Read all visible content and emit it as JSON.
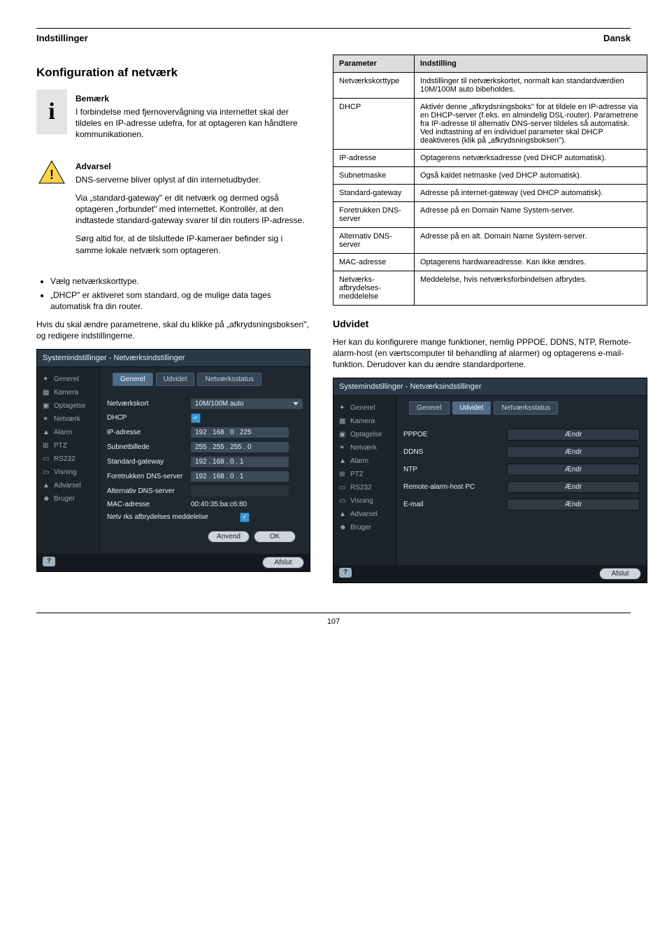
{
  "header": {
    "left": "Indstillinger",
    "right": "Dansk"
  },
  "left_col": {
    "h2": "Konfiguration af netværk",
    "note_heading": "Bemærk",
    "note_text": "I forbindelse med fjernovervågning via internettet skal der tildeles en IP-adresse udefra, for at optageren kan håndtere kommunikationen.",
    "warn_heading": "Advarsel",
    "warn_body": [
      "DNS-serverne bliver oplyst af din internetudbyder.",
      "Via „standard-gateway\" er dit netværk og dermed også optageren „forbundet\" med internettet. Kontrollér, at den indtastede standard-gateway svarer til din routers IP-adresse.",
      "Sørg altid for, at de tilsluttede IP-kameraer befinder sig i samme lokale netværk som optageren."
    ],
    "bullets": [
      "Vælg netværkskorttype.",
      "„DHCP\" er aktiveret som standard, og de mulige data tages automatisk fra din router."
    ],
    "ptext": "Hvis du skal ændre parametrene, skal du klikke på „afkrydsningsboksen\", og redigere indstillingerne."
  },
  "right_col": {
    "params": [
      {
        "p": "Parameter",
        "e": "Indstilling"
      },
      {
        "p": "Netværkskorttype",
        "e": "Indstillinger til netværkskortet, normalt kan standardværdien 10M/100M auto bibeholdes."
      },
      {
        "p": "DHCP",
        "e": "Aktivér denne „afkrydsningsboks\" for at tildele en IP-adresse via en DHCP-server (f.eks. en almindelig DSL-router). Parametrene fra IP-adresse til alternativ DNS-server tildeles så automatisk. Ved indtastning af en individuel parameter skal DHCP deaktiveres (klik på „afkrydsningsboksen\")."
      },
      {
        "p": "IP-adresse",
        "e": "Optagerens netværksadresse (ved DHCP automatisk)."
      },
      {
        "p": "Subnetmaske",
        "e": "Også kaldet netmaske (ved DHCP automatisk)."
      },
      {
        "p": "Standard-gateway",
        "e": "Adresse på internet-gateway (ved DHCP automatisk)."
      },
      {
        "p": "Foretrukken DNS-server",
        "e": "Adresse på en Domain Name System-server."
      },
      {
        "p": "Alternativ DNS-server",
        "e": "Adresse på en alt. Domain Name System-server."
      },
      {
        "p": "MAC-adresse",
        "e": "Optagerens hardwareadresse. Kan ikke ændres."
      },
      {
        "p": "Netværks-afbrydelses-meddelelse",
        "e": "Meddelelse, hvis netværksforbindelsen afbrydes."
      }
    ],
    "h3": "Udvidet",
    "ptext": "Her kan du konfigurere mange funktioner, nemlig PPPOE, DDNS, NTP, Remote-alarm-host (en værtscomputer til behandling af alarmer) og optagerens e-mail-funktion. Derudover kan du ændre standardportene."
  },
  "shot1": {
    "title": "Systemindstillinger - Netværksindstillinger",
    "sidebar": [
      "Generel",
      "Kamera",
      "Optagelse",
      "Netværk",
      "Alarm",
      "PTZ",
      "RS232",
      "Visning",
      "Advarsel",
      "Bruger"
    ],
    "tabs": [
      "Generel",
      "Udvidet",
      "Netværksstatus"
    ],
    "active_tab": 0,
    "rows": {
      "card_label": "Netværkskort",
      "card_value": "10M/100M auto",
      "dhcp_label": "DHCP",
      "ip_label": "IP-adresse",
      "ip_value": "192 . 168 . 0    . 225",
      "mask_label": "Subnetbillede",
      "mask_value": "255 . 255 . 255 . 0",
      "gw_label": "Standard-gateway",
      "gw_value": "192 . 168 . 0    . 1",
      "dns1_label": "Foretrukken DNS-server",
      "dns1_value": "192 . 168 . 0    . 1",
      "dns2_label": "Alternativ DNS-server",
      "dns2_value": "·       ·       ·",
      "mac_label": "MAC-adresse",
      "mac_value": "00:40:35:ba:c6:80",
      "disc_label": "Netv rks afbrydelses meddelelse"
    },
    "buttons": {
      "apply": "Anvend",
      "ok": "OK",
      "exit": "Afslut"
    }
  },
  "shot2": {
    "title": "Systemindstillinger - Netværksindstillinger",
    "sidebar": [
      "Generel",
      "Kamera",
      "Optagelse",
      "Netværk",
      "Alarm",
      "PTZ",
      "RS232",
      "Visning",
      "Advarsel",
      "Bruger"
    ],
    "tabs": [
      "Generel",
      "Udvidet",
      "Netværksstatus"
    ],
    "active_tab": 1,
    "items": [
      {
        "label": "PPPOE",
        "btn": "Ændr"
      },
      {
        "label": "DDNS",
        "btn": "Ændr"
      },
      {
        "label": "NTP",
        "btn": "Ændr"
      },
      {
        "label": "Remote-alarm-host PC",
        "btn": "Ændr"
      },
      {
        "label": "E-mail",
        "btn": "Ændr"
      }
    ],
    "exit": "Afslut"
  },
  "footer": "107"
}
